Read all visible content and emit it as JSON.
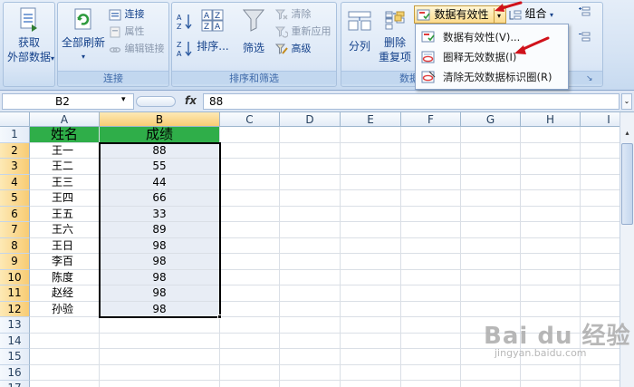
{
  "ribbon": {
    "get_external": {
      "line1": "获取",
      "line2": "外部数据"
    },
    "connections": {
      "refresh_all": "全部刷新",
      "connections": "连接",
      "properties": "属性",
      "edit_links": "编辑链接",
      "label": "连接"
    },
    "sort_filter": {
      "sort": "排序...",
      "filter": "筛选",
      "clear": "清除",
      "reapply": "重新应用",
      "advanced": "高级",
      "label": "排序和筛选"
    },
    "data_tools": {
      "split": "分列",
      "remove_dup": {
        "line1": "删除",
        "line2": "重复项"
      },
      "data_validation": "数据有效性",
      "label": "数据"
    },
    "outline": {
      "group": "组合"
    }
  },
  "dropdown": {
    "items": [
      {
        "label": "数据有效性(V)..."
      },
      {
        "label": "圈释无效数据(I)"
      },
      {
        "label": "清除无效数据标识圈(R)"
      }
    ]
  },
  "formula_bar": {
    "name_box": "B2",
    "fx": "fx",
    "value": "88"
  },
  "sheet": {
    "columns": [
      "A",
      "B",
      "C",
      "D",
      "E",
      "F",
      "G",
      "H",
      "I"
    ],
    "row_numbers": [
      "1",
      "2",
      "3",
      "4",
      "5",
      "6",
      "7",
      "8",
      "9",
      "10",
      "11",
      "12",
      "13",
      "14",
      "15",
      "16",
      "17"
    ],
    "header": {
      "name": "姓名",
      "score": "成绩"
    },
    "rows": [
      {
        "name": "王一",
        "score": "88"
      },
      {
        "name": "王二",
        "score": "55"
      },
      {
        "name": "王三",
        "score": "44"
      },
      {
        "name": "王四",
        "score": "66"
      },
      {
        "name": "王五",
        "score": "33"
      },
      {
        "name": "王六",
        "score": "89"
      },
      {
        "name": "王日",
        "score": "98"
      },
      {
        "name": "李百",
        "score": "98"
      },
      {
        "name": "陈度",
        "score": "98"
      },
      {
        "name": "赵经",
        "score": "98"
      },
      {
        "name": "孙验",
        "score": "98"
      }
    ]
  },
  "watermark": {
    "main": "Bai du 经验",
    "sub": "jingyan.baidu.com"
  },
  "colors": {
    "header_fill": "#2fae49",
    "score_fill": "#e8edf5",
    "arrow": "#d0121b"
  }
}
